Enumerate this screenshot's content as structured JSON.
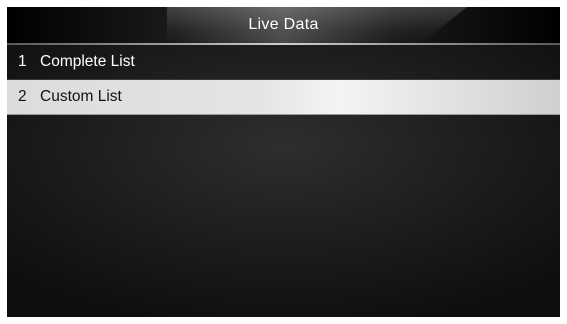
{
  "header": {
    "title": "Live  Data"
  },
  "menu": {
    "items": [
      {
        "number": "1",
        "label": "Complete List",
        "selected": false
      },
      {
        "number": "2",
        "label": "Custom List",
        "selected": true
      }
    ]
  }
}
